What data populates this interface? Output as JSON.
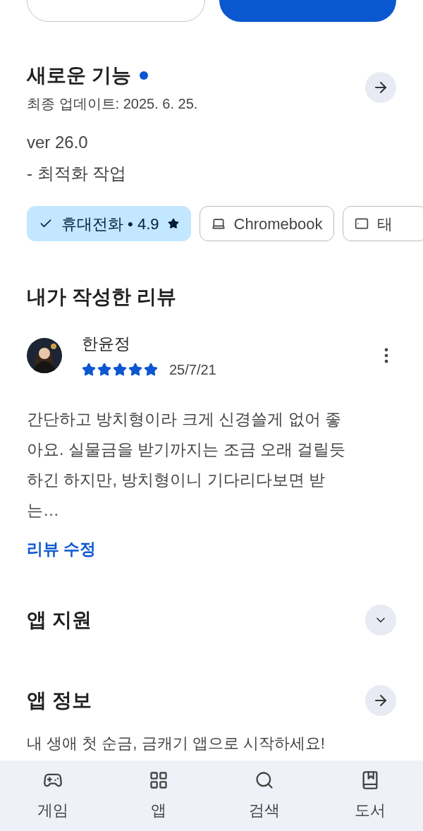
{
  "top_buttons": [
    {
      "kind": "outlined"
    },
    {
      "kind": "filled"
    }
  ],
  "whats_new": {
    "title": "새로운 기능",
    "new_dot": true,
    "updated": "최종 업데이트: 2025. 6. 25.",
    "notes": [
      "ver 26.0",
      "- 최적화 작업"
    ]
  },
  "devices": [
    {
      "label": "휴대전화 • 4.9",
      "rating_star": true,
      "selected": true
    },
    {
      "kind": "laptop",
      "label": "Chromebook",
      "rating_star": false,
      "selected": false
    },
    {
      "kind": "tablet",
      "label": "태",
      "rating_star": false,
      "selected": false
    }
  ],
  "my_review": {
    "title": "내가 작성한 리뷰",
    "author": "한윤정",
    "stars": 5,
    "date": "25/7/21",
    "text": "간단하고 방치형이라 크게 신경쓸게 없어 좋아요. 실물금을 받기까지는 조금 오래 걸릴듯 하긴 하지만, 방치형이니 기다리다보면 받는…",
    "edit_link": "리뷰 수정"
  },
  "sections": [
    {
      "title": "앱 지원",
      "kind": "expand"
    },
    {
      "title": "앱 정보",
      "kind": "arrow",
      "description": "내 생애 첫 순금, 금캐기 앱으로 시작하세요!"
    }
  ],
  "bottom_nav": [
    {
      "kind": "games",
      "label": "게임",
      "selected": false
    },
    {
      "kind": "apps",
      "label": "앱",
      "selected": false
    },
    {
      "kind": "search",
      "label": "검색",
      "selected": false
    },
    {
      "kind": "books",
      "label": "도서",
      "selected": false
    }
  ]
}
